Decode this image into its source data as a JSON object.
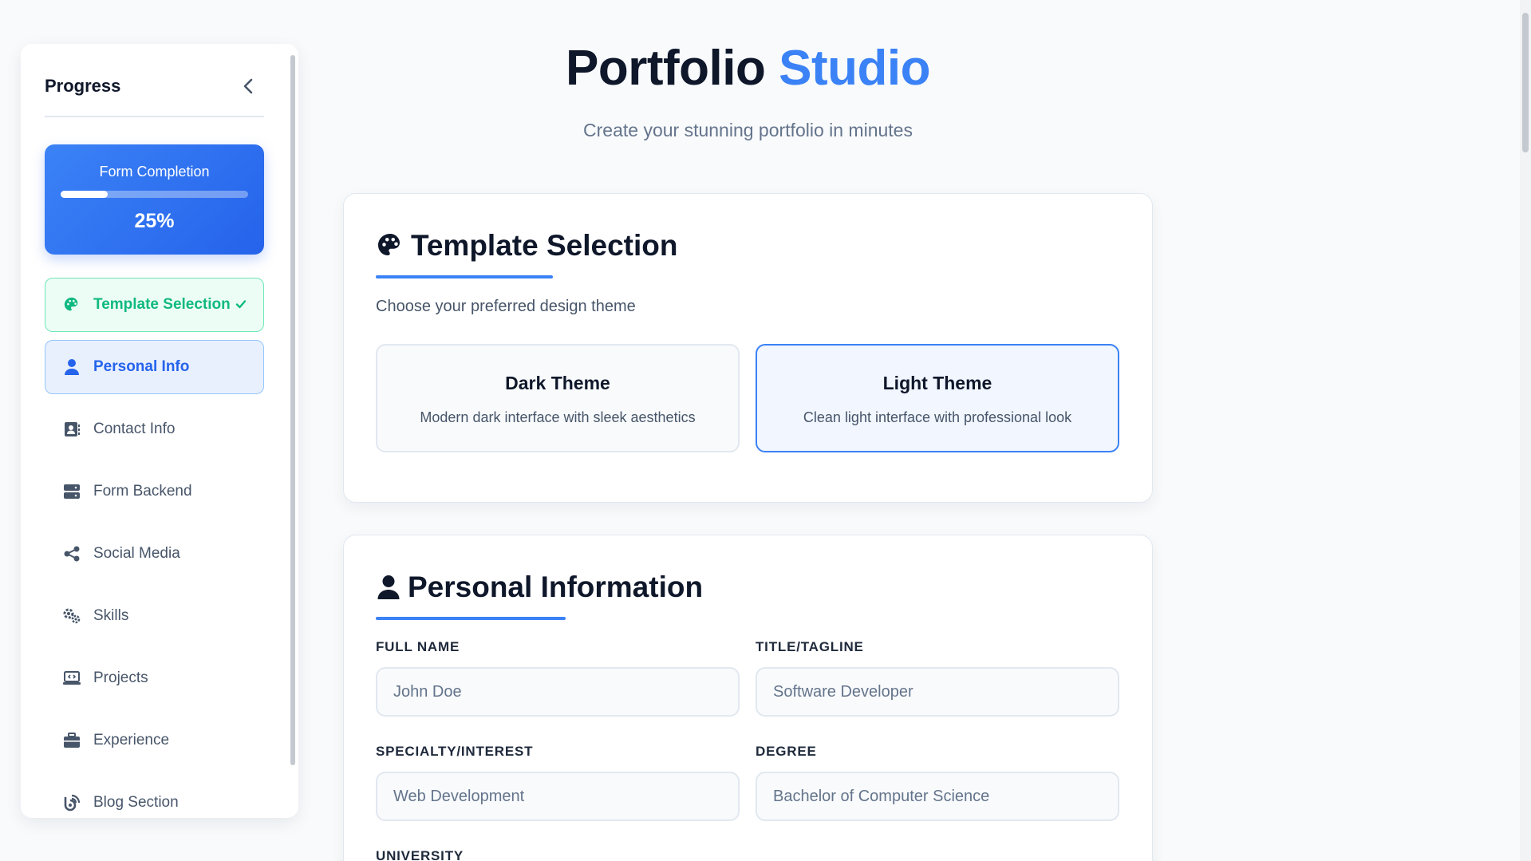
{
  "sidebar": {
    "title": "Progress",
    "progress": {
      "label": "Form Completion",
      "percent_text": "25%",
      "fraction": 0.25
    },
    "items": [
      {
        "label": "Template Selection",
        "icon": "palette-icon",
        "state": "done"
      },
      {
        "label": "Personal Info",
        "icon": "user-icon",
        "state": "active"
      },
      {
        "label": "Contact Info",
        "icon": "address-book-icon",
        "state": "default"
      },
      {
        "label": "Form Backend",
        "icon": "server-icon",
        "state": "default"
      },
      {
        "label": "Social Media",
        "icon": "share-icon",
        "state": "default"
      },
      {
        "label": "Skills",
        "icon": "gears-icon",
        "state": "default"
      },
      {
        "label": "Projects",
        "icon": "laptop-code-icon",
        "state": "default"
      },
      {
        "label": "Experience",
        "icon": "briefcase-icon",
        "state": "default"
      },
      {
        "label": "Blog Section",
        "icon": "blog-icon",
        "state": "default"
      }
    ]
  },
  "header": {
    "title_main": "Portfolio",
    "title_accent": "Studio",
    "subtitle": "Create your stunning portfolio in minutes"
  },
  "template_section": {
    "title": "Template Selection",
    "description": "Choose your preferred design theme",
    "themes": [
      {
        "name": "Dark Theme",
        "description": "Modern dark interface with sleek aesthetics",
        "selected": false
      },
      {
        "name": "Light Theme",
        "description": "Clean light interface with professional look",
        "selected": true
      }
    ]
  },
  "personal_section": {
    "title": "Personal Information",
    "fields": {
      "full_name": {
        "label": "FULL NAME",
        "placeholder": "John Doe"
      },
      "title": {
        "label": "TITLE/TAGLINE",
        "placeholder": "Software Developer"
      },
      "specialty": {
        "label": "SPECIALTY/INTEREST",
        "placeholder": "Web Development"
      },
      "degree": {
        "label": "DEGREE",
        "placeholder": "Bachelor of Computer Science"
      },
      "university": {
        "label": "UNIVERSITY"
      }
    }
  },
  "colors": {
    "accent": "#3b82f6",
    "done_green": "#10b981",
    "text_dark": "#0f172a",
    "text_muted": "#64748b"
  }
}
